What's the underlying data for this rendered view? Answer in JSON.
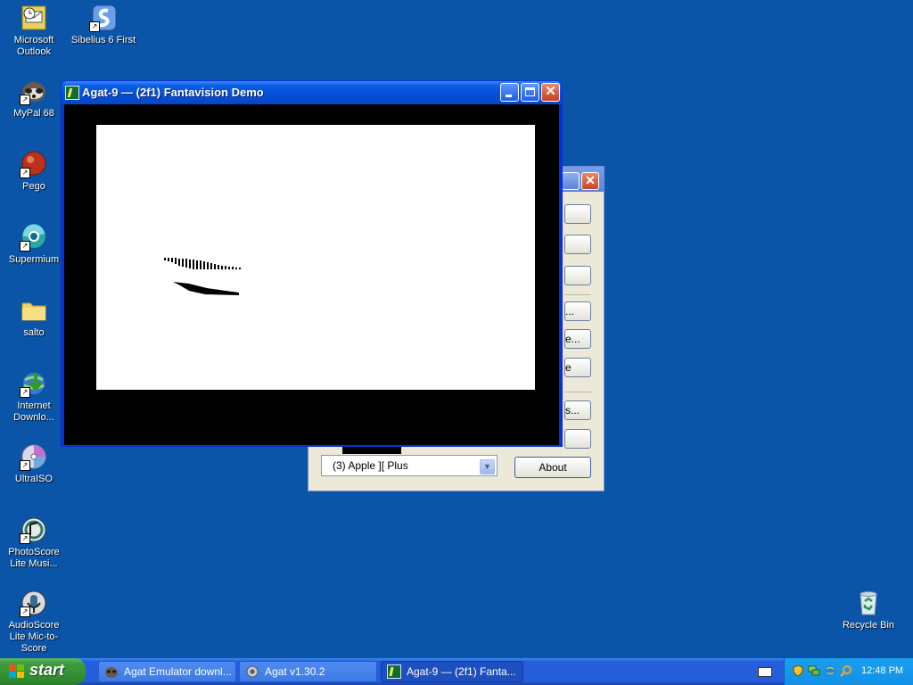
{
  "desktop": {
    "icons": [
      {
        "label": "Microsoft Outlook",
        "icon": "outlook-icon"
      },
      {
        "label": "Sibelius 6 First",
        "icon": "sibelius-icon"
      },
      {
        "label": "MyPal 68",
        "icon": "mypal-icon"
      },
      {
        "label": "Pego",
        "icon": "pego-icon"
      },
      {
        "label": "Supermium",
        "icon": "supermium-icon"
      },
      {
        "label": "salto",
        "icon": "folder-icon"
      },
      {
        "label": "Internet Downlo...",
        "icon": "internet-download-icon"
      },
      {
        "label": "UltraISO",
        "icon": "ultraiso-icon"
      },
      {
        "label": "PhotoScore Lite Musi...",
        "icon": "photoscore-icon"
      },
      {
        "label": "AudioScore Lite Mic-to-Score",
        "icon": "audioscore-icon"
      },
      {
        "label": "Recycle Bin",
        "icon": "recycle-bin-icon"
      }
    ]
  },
  "agat_window": {
    "button_fragments": [
      "",
      "",
      "",
      "...",
      "e...",
      "e",
      "s...",
      ""
    ],
    "model_select": {
      "value": "(3) Apple ][ Plus"
    },
    "about_label": "About"
  },
  "demo_window": {
    "title": "Agat-9 — (2f1) Fantavision Demo",
    "close_glyph": "✕"
  },
  "taskbar": {
    "start_label": "start",
    "tasks": [
      {
        "label": "Agat Emulator downl..."
      },
      {
        "label": "Agat v1.30.2"
      },
      {
        "label": "Agat-9 — (2f1) Fanta..."
      }
    ],
    "clock": "12:48 PM"
  },
  "colors": {
    "desktop": "#0a55a8",
    "xp_blue_title": "#0550d8",
    "start_green": "#3c9c3c"
  }
}
